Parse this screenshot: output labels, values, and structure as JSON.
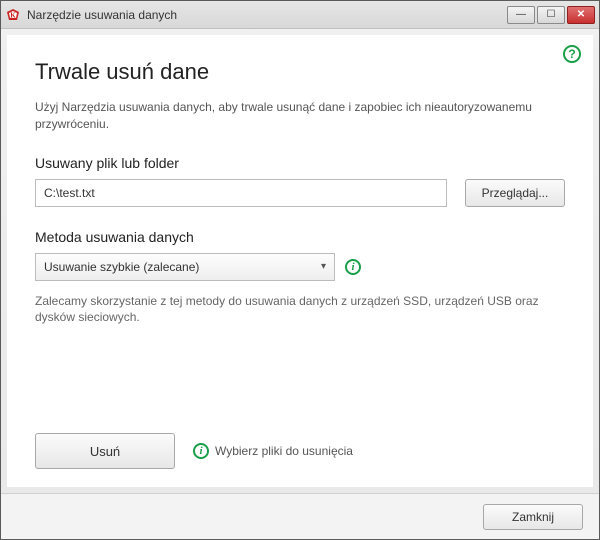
{
  "window": {
    "title": "Narzędzie usuwania danych"
  },
  "help": {
    "glyph": "?"
  },
  "main": {
    "title": "Trwale usuń dane",
    "intro": "Użyj Narzędzia usuwania danych, aby trwale usunąć dane i zapobiec ich nieautoryzowanemu przywróceniu.",
    "file_section_label": "Usuwany plik lub folder",
    "file_value": "C:\\test.txt",
    "browse_label": "Przeglądaj...",
    "method_section_label": "Metoda usuwania danych",
    "method_selected": "Usuwanie szybkie (zalecane)",
    "method_desc": "Zalecamy skorzystanie z tej metody do usuwania danych z urządzeń SSD, urządzeń USB oraz dysków sieciowych.",
    "delete_label": "Usuń",
    "hint_text": "Wybierz pliki do usunięcia"
  },
  "footer": {
    "close_label": "Zamknij"
  },
  "glyphs": {
    "info": "i",
    "chevron_down": "▾",
    "minimize": "—",
    "maximize": "☐",
    "close": "✕"
  }
}
